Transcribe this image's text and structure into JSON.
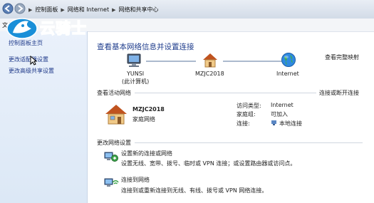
{
  "address_bar": {
    "crumbs": [
      "控制面板",
      "网络和 Internet",
      "网络和共享中心"
    ]
  },
  "menu": {
    "file": "文件(F"
  },
  "watermark": {
    "text": "云骑士"
  },
  "sidebar": {
    "items": [
      {
        "label": "控制面板主页"
      },
      {
        "label": "更改适配器设置"
      },
      {
        "label": "更改高级共享设置"
      }
    ]
  },
  "main": {
    "title": "查看基本网络信息并设置连接",
    "view_full_map": "查看完整映射",
    "map": {
      "computer_name": "YUNSI",
      "computer_sub": "(此计算机)",
      "network_name": "MZJC2018",
      "internet": "Internet"
    },
    "active_networks": {
      "header": "查看活动网络",
      "connect_disconnect": "连接或断开连接",
      "network_name": "MZJC2018",
      "network_type": "家庭网络",
      "access_type_label": "访问类型:",
      "access_type_value": "Internet",
      "homegroup_label": "家庭组:",
      "homegroup_value": "可加入",
      "connections_label": "连接:",
      "connections_value": "本地连接"
    },
    "change_settings": {
      "header": "更改网络设置",
      "tasks": [
        {
          "title": "设置新的连接或网络",
          "desc": "设置无线、宽带、拨号、临时或 VPN 连接；或设置路由器或访问点。"
        },
        {
          "title": "连接到网络",
          "desc": "连接到或重新连接到无线、有线、拨号或 VPN 网络连接。"
        }
      ]
    }
  },
  "colors": {
    "link": "#1a56c4",
    "title": "#1e3c8c",
    "sidebar_bg": "#e3ecf8"
  }
}
